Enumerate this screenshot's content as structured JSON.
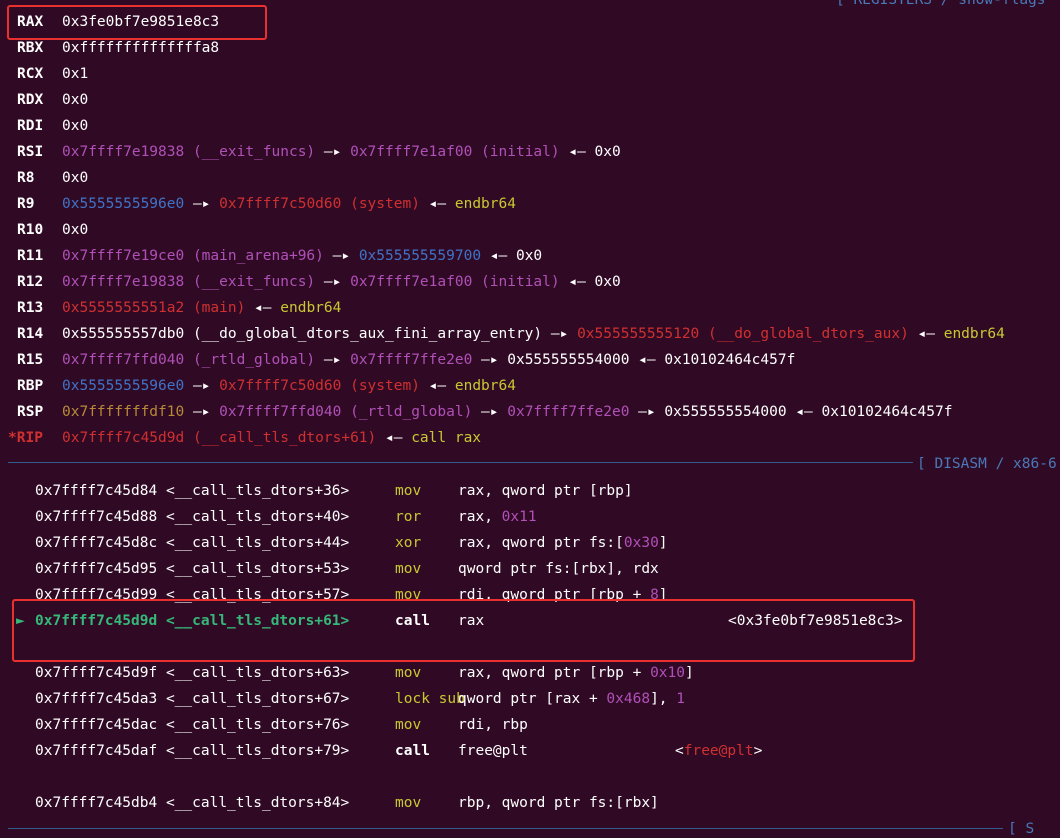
{
  "headers": {
    "registers": "[ REGISTERS / show-flags",
    "disasm": "[ DISASM / x86-6",
    "bottom": "[ S"
  },
  "registers": [
    {
      "name": "RAX",
      "modified": false,
      "parts": [
        {
          "t": "0x3fe0bf7e9851e8c3",
          "c": "w"
        }
      ]
    },
    {
      "name": "RBX",
      "modified": false,
      "parts": [
        {
          "t": "0xffffffffffffffa8",
          "c": "w"
        }
      ]
    },
    {
      "name": "RCX",
      "modified": false,
      "parts": [
        {
          "t": "0x1",
          "c": "w"
        }
      ]
    },
    {
      "name": "RDX",
      "modified": false,
      "parts": [
        {
          "t": "0x0",
          "c": "w"
        }
      ]
    },
    {
      "name": "RDI",
      "modified": false,
      "parts": [
        {
          "t": "0x0",
          "c": "w"
        }
      ]
    },
    {
      "name": "RSI",
      "modified": false,
      "parts": [
        {
          "t": "0x7ffff7e19838 (__exit_funcs)",
          "c": "mag"
        },
        {
          "t": " —▸ ",
          "c": "w"
        },
        {
          "t": "0x7ffff7e1af00 (initial)",
          "c": "mag"
        },
        {
          "t": " ◂— 0x0",
          "c": "w"
        }
      ]
    },
    {
      "name": "R8",
      "modified": false,
      "parts": [
        {
          "t": "0x0",
          "c": "w"
        }
      ]
    },
    {
      "name": "R9",
      "modified": false,
      "parts": [
        {
          "t": "0x5555555596e0",
          "c": "blue"
        },
        {
          "t": " —▸ ",
          "c": "w"
        },
        {
          "t": "0x7ffff7c50d60 (system)",
          "c": "red"
        },
        {
          "t": " ◂— ",
          "c": "w"
        },
        {
          "t": "endbr64",
          "c": "yel"
        }
      ]
    },
    {
      "name": "R10",
      "modified": false,
      "parts": [
        {
          "t": "0x0",
          "c": "w"
        }
      ]
    },
    {
      "name": "R11",
      "modified": false,
      "parts": [
        {
          "t": "0x7ffff7e19ce0 (main_arena+96)",
          "c": "mag"
        },
        {
          "t": " —▸ ",
          "c": "w"
        },
        {
          "t": "0x555555559700",
          "c": "blue"
        },
        {
          "t": " ◂— 0x0",
          "c": "w"
        }
      ]
    },
    {
      "name": "R12",
      "modified": false,
      "parts": [
        {
          "t": "0x7ffff7e19838 (__exit_funcs)",
          "c": "mag"
        },
        {
          "t": " —▸ ",
          "c": "w"
        },
        {
          "t": "0x7ffff7e1af00 (initial)",
          "c": "mag"
        },
        {
          "t": " ◂— 0x0",
          "c": "w"
        }
      ]
    },
    {
      "name": "R13",
      "modified": false,
      "parts": [
        {
          "t": "0x5555555551a2 (main)",
          "c": "red"
        },
        {
          "t": " ◂— ",
          "c": "w"
        },
        {
          "t": "endbr64",
          "c": "yel"
        }
      ]
    },
    {
      "name": "R14",
      "modified": false,
      "parts": [
        {
          "t": "0x555555557db0 (__do_global_dtors_aux_fini_array_entry)",
          "c": "w"
        },
        {
          "t": " —▸ ",
          "c": "w"
        },
        {
          "t": "0x555555555120 (__do_global_dtors_aux)",
          "c": "red"
        },
        {
          "t": " ◂— ",
          "c": "w"
        },
        {
          "t": "endbr64",
          "c": "yel"
        }
      ]
    },
    {
      "name": "R15",
      "modified": false,
      "parts": [
        {
          "t": "0x7ffff7ffd040 (_rtld_global)",
          "c": "mag"
        },
        {
          "t": " —▸ ",
          "c": "w"
        },
        {
          "t": "0x7ffff7ffe2e0",
          "c": "mag"
        },
        {
          "t": " —▸ 0x555555554000 ◂— 0x10102464c457f",
          "c": "w"
        }
      ]
    },
    {
      "name": "RBP",
      "modified": false,
      "parts": [
        {
          "t": "0x5555555596e0",
          "c": "blue"
        },
        {
          "t": " —▸ ",
          "c": "w"
        },
        {
          "t": "0x7ffff7c50d60 (system)",
          "c": "red"
        },
        {
          "t": " ◂— ",
          "c": "w"
        },
        {
          "t": "endbr64",
          "c": "yel"
        }
      ]
    },
    {
      "name": "RSP",
      "modified": false,
      "parts": [
        {
          "t": "0x7fffffffdf10",
          "c": "org"
        },
        {
          "t": " —▸ ",
          "c": "w"
        },
        {
          "t": "0x7ffff7ffd040 (_rtld_global)",
          "c": "mag"
        },
        {
          "t": " —▸ ",
          "c": "w"
        },
        {
          "t": "0x7ffff7ffe2e0",
          "c": "mag"
        },
        {
          "t": " —▸ 0x555555554000 ◂— 0x10102464c457f",
          "c": "w"
        }
      ]
    },
    {
      "name": "*RIP",
      "modified": true,
      "parts": [
        {
          "t": "0x7ffff7c45d9d (__call_tls_dtors+61)",
          "c": "red"
        },
        {
          "t": " ◂— ",
          "c": "w"
        },
        {
          "t": "call rax",
          "c": "yel"
        }
      ]
    }
  ],
  "disasm": [
    {
      "addr": "0x7ffff7c45d84 <__call_tls_dtors+36>",
      "mn": "mov",
      "current": false,
      "ops": [
        {
          "t": "rax, qword ptr [rbp]",
          "c": "w"
        }
      ]
    },
    {
      "addr": "0x7ffff7c45d88 <__call_tls_dtors+40>",
      "mn": "ror",
      "current": false,
      "ops": [
        {
          "t": "rax, ",
          "c": "w"
        },
        {
          "t": "0x11",
          "c": "mag"
        }
      ]
    },
    {
      "addr": "0x7ffff7c45d8c <__call_tls_dtors+44>",
      "mn": "xor",
      "current": false,
      "ops": [
        {
          "t": "rax, qword ptr fs:[",
          "c": "w"
        },
        {
          "t": "0x30",
          "c": "mag"
        },
        {
          "t": "]",
          "c": "w"
        }
      ]
    },
    {
      "addr": "0x7ffff7c45d95 <__call_tls_dtors+53>",
      "mn": "mov",
      "current": false,
      "ops": [
        {
          "t": "qword ptr fs:[rbx], rdx",
          "c": "w"
        }
      ]
    },
    {
      "addr": "0x7ffff7c45d99 <__call_tls_dtors+57>",
      "mn": "mov",
      "current": false,
      "ops": [
        {
          "t": "rdi, qword ptr [rbp + ",
          "c": "w"
        },
        {
          "t": "8",
          "c": "mag"
        },
        {
          "t": "]",
          "c": "w"
        }
      ]
    },
    {
      "addr": "0x7ffff7c45d9d <__call_tls_dtors+61>",
      "mn": "call",
      "current": true,
      "ops": [
        {
          "t": "rax",
          "c": "w"
        }
      ],
      "extra": "<0x3fe0bf7e9851e8c3>",
      "extra_c": "w"
    },
    {
      "addr": "",
      "mn": "",
      "current": false,
      "ops": []
    },
    {
      "addr": "0x7ffff7c45d9f <__call_tls_dtors+63>",
      "mn": "mov",
      "current": false,
      "ops": [
        {
          "t": "rax, qword ptr [rbp + ",
          "c": "w"
        },
        {
          "t": "0x10",
          "c": "mag"
        },
        {
          "t": "]",
          "c": "w"
        }
      ]
    },
    {
      "addr": "0x7ffff7c45da3 <__call_tls_dtors+67>",
      "mn": "lock sub",
      "current": false,
      "ops": [
        {
          "t": "qword ptr [rax + ",
          "c": "w"
        },
        {
          "t": "0x468",
          "c": "mag"
        },
        {
          "t": "], ",
          "c": "w"
        },
        {
          "t": "1",
          "c": "mag"
        }
      ]
    },
    {
      "addr": "0x7ffff7c45dac <__call_tls_dtors+76>",
      "mn": "mov",
      "current": false,
      "ops": [
        {
          "t": "rdi, rbp",
          "c": "w"
        }
      ]
    },
    {
      "addr": "0x7ffff7c45daf <__call_tls_dtors+79>",
      "mn": "call",
      "current": false,
      "bold_mn": true,
      "ops": [
        {
          "t": "free@plt",
          "c": "w"
        }
      ],
      "extra_parts": [
        {
          "t": "<",
          "c": "w"
        },
        {
          "t": "free@plt",
          "c": "red"
        },
        {
          "t": ">",
          "c": "w"
        }
      ]
    },
    {
      "addr": "",
      "mn": "",
      "current": false,
      "ops": []
    },
    {
      "addr": "0x7ffff7c45db4 <__call_tls_dtors+84>",
      "mn": "mov",
      "current": false,
      "ops": [
        {
          "t": "rbp, qword ptr fs:[rbx]",
          "c": "w"
        }
      ]
    }
  ],
  "marker": "►",
  "colors": {
    "background": "#300a24",
    "magenta": "#b050b8",
    "red": "#d03030",
    "blue": "#3f73c8",
    "yellow": "#c8c832",
    "orange": "#b88a38",
    "green": "#35b879",
    "annotation": "#e8312e"
  }
}
